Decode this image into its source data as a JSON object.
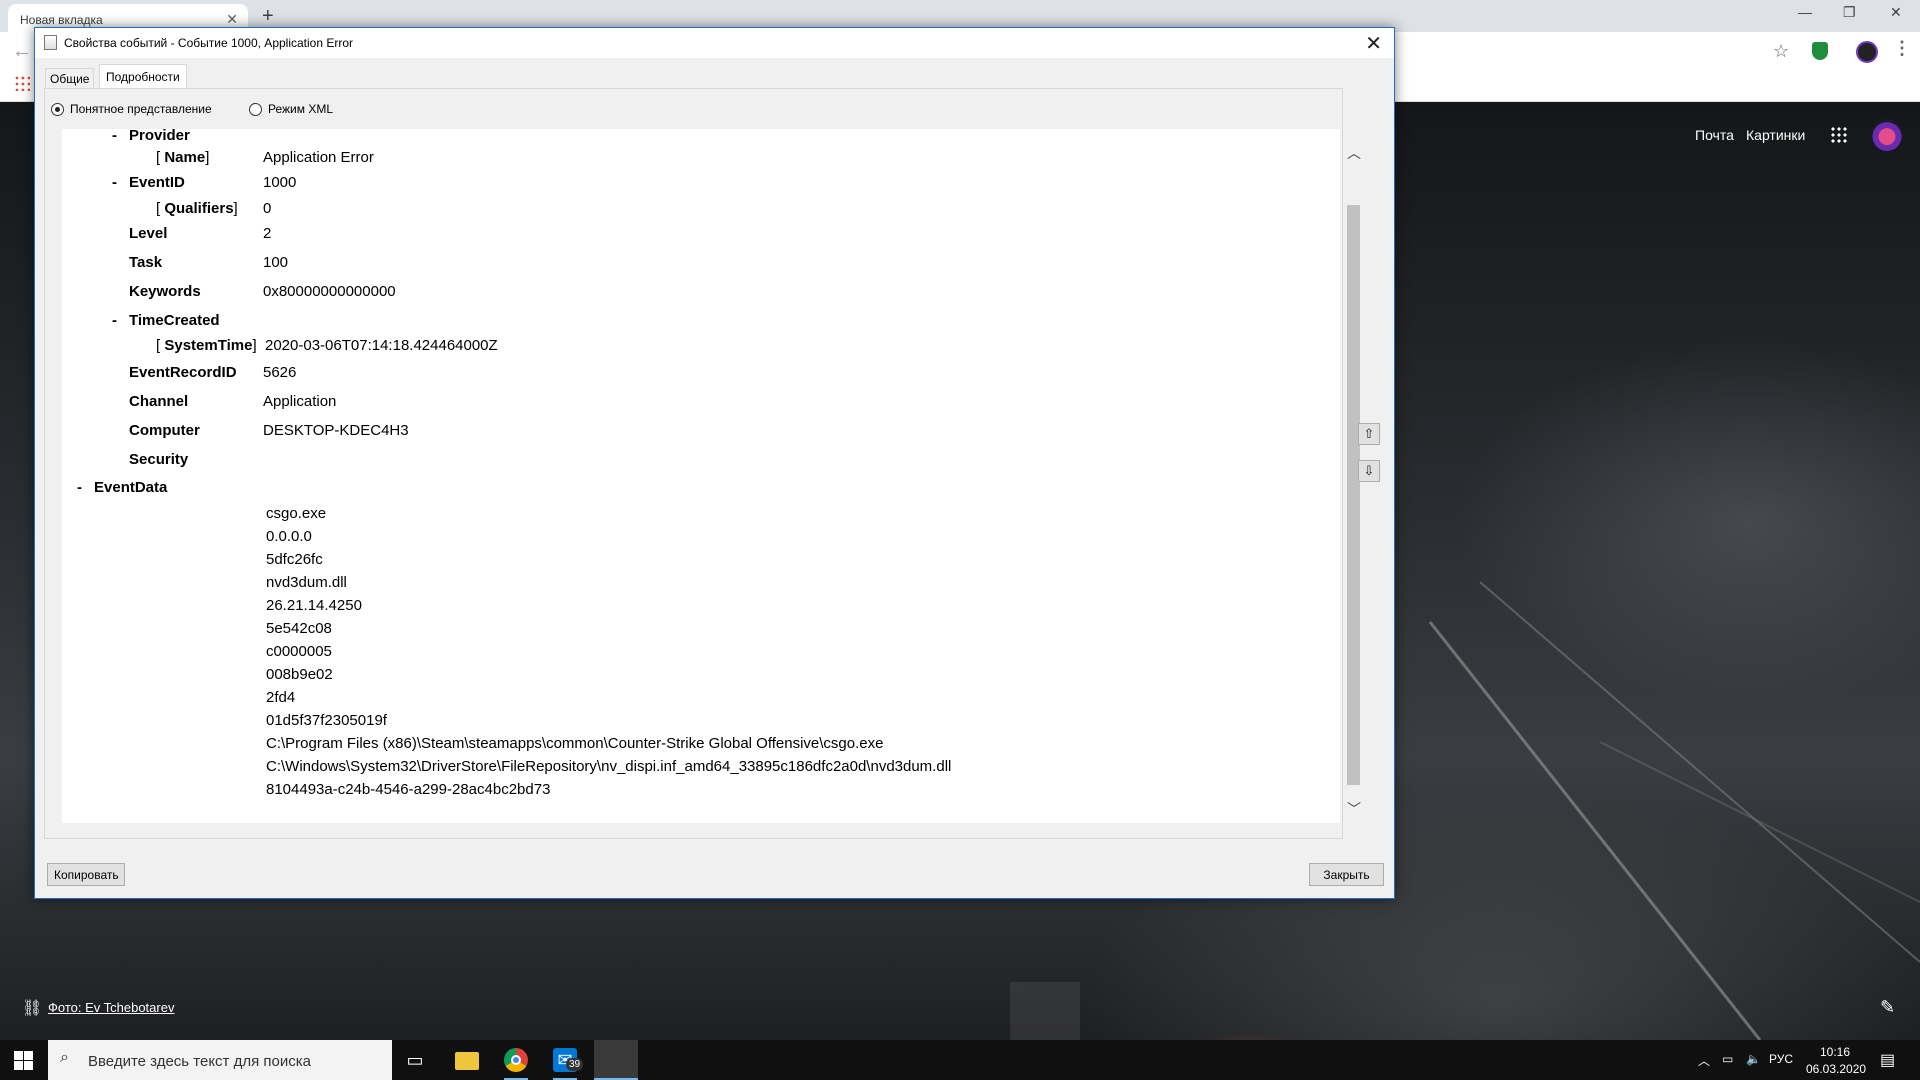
{
  "browser": {
    "tab_title": "Новая вкладка",
    "google_links": {
      "mail": "Почта",
      "images": "Картинки"
    },
    "photo_credit": "Фото: Ev Tchebotarev"
  },
  "dialog": {
    "title": "Свойства событий - Событие 1000, Application Error",
    "tabs": [
      "Общие",
      "Подробности"
    ],
    "active_tab": "Подробности",
    "view_modes": {
      "friendly": "Понятное представление",
      "xml": "Режим XML"
    },
    "selected_view": "friendly",
    "details": {
      "provider_label": "Provider",
      "name_label": "Name",
      "name_value": "Application Error",
      "eventid_label": "EventID",
      "eventid_value": "1000",
      "qualifiers_label": "Qualifiers",
      "qualifiers_value": "0",
      "level_label": "Level",
      "level_value": "2",
      "task_label": "Task",
      "task_value": "100",
      "keywords_label": "Keywords",
      "keywords_value": "0x80000000000000",
      "timecreated_label": "TimeCreated",
      "systemtime_label": "SystemTime",
      "systemtime_value": "2020-03-06T07:14:18.424464000Z",
      "recordid_label": "EventRecordID",
      "recordid_value": "5626",
      "channel_label": "Channel",
      "channel_value": "Application",
      "computer_label": "Computer",
      "computer_value": "DESKTOP-KDEC4H3",
      "security_label": "Security",
      "eventdata_label": "EventData",
      "eventdata": [
        "csgo.exe",
        "0.0.0.0",
        "5dfc26fc",
        "nvd3dum.dll",
        "26.21.14.4250",
        "5e542c08",
        "c0000005",
        "008b9e02",
        "2fd4",
        "01d5f37f2305019f",
        "C:\\Program Files (x86)\\Steam\\steamapps\\common\\Counter-Strike Global Offensive\\csgo.exe",
        "C:\\Windows\\System32\\DriverStore\\FileRepository\\nv_dispi.inf_amd64_33895c186dfc2a0d\\nvd3dum.dll",
        "8104493a-c24b-4546-a299-28ac4bc2bd73"
      ]
    },
    "buttons": {
      "copy": "Копировать",
      "close": "Закрыть"
    }
  },
  "taskbar": {
    "search_placeholder": "Введите здесь текст для поиска",
    "mail_badge": "39",
    "language": "РУС",
    "time": "10:16",
    "date": "06.03.2020"
  }
}
